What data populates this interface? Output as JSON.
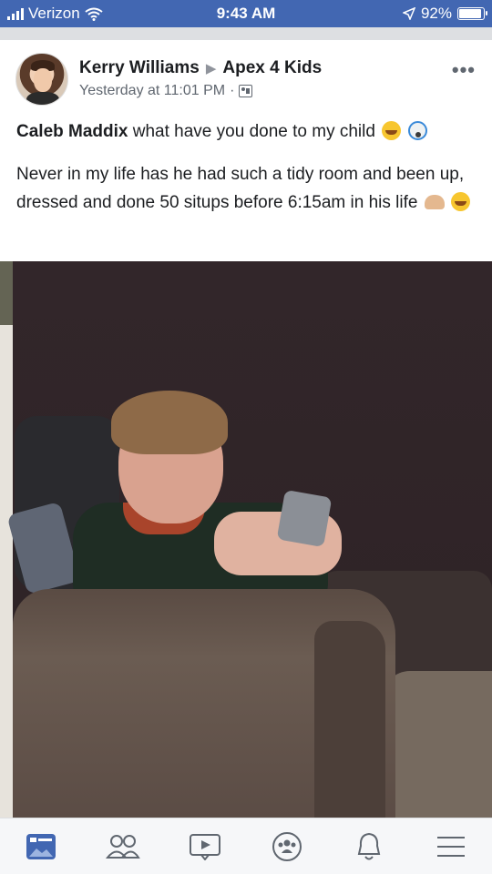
{
  "status_bar": {
    "carrier": "Verizon",
    "time": "9:43 AM",
    "battery": "92%",
    "battery_level": 0.92,
    "signal_icon": "signal-bars-icon",
    "wifi_icon": "wifi-icon",
    "location_icon": "location-arrow-icon"
  },
  "post": {
    "author": "Kerry Williams",
    "group": "Apex 4 Kids",
    "timestamp": "Yesterday at 11:01 PM",
    "separator": "·",
    "audience_icon": "group-audience-icon",
    "more_icon": "more-options-icon",
    "mention": "Caleb Maddix",
    "line1_rest": "what have you done to my child",
    "line2": "Never in my life has he had such a tidy room and been up, dressed and done 50 situps before 6:15am in his life",
    "photo_description_icon": "photo"
  },
  "tab_bar": {
    "items": [
      "news-feed-icon",
      "friends-icon",
      "watch-icon",
      "groups-icon",
      "notifications-icon",
      "menu-icon"
    ],
    "active": "news-feed-icon",
    "accent": "#4267b2",
    "inactive_color": "#606770"
  },
  "colors": {
    "brand_blue": "#4267b2",
    "text": "#1c1e21",
    "secondary_text": "#606770"
  }
}
